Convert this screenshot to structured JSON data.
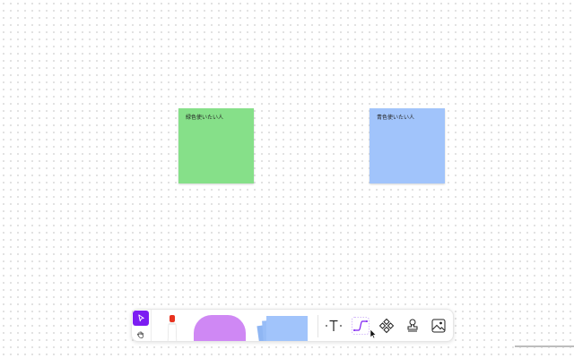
{
  "canvas": {
    "notes": [
      {
        "text": "緑色使いたい人",
        "color": "#86e089"
      },
      {
        "text": "青色使いたい人",
        "color": "#a1c4fb"
      }
    ]
  },
  "toolbar": {
    "modes": [
      {
        "name": "select",
        "icon": "pointer-icon",
        "active": true,
        "accent": "#7c1cf2"
      },
      {
        "name": "hand",
        "icon": "hand-icon",
        "active": false
      }
    ],
    "tools": [
      {
        "name": "marker",
        "icon": "marker-icon",
        "tip_color": "#e8321f"
      },
      {
        "name": "shape",
        "icon": "shape-icon",
        "color": "#cf88f4"
      },
      {
        "name": "sticky-note",
        "icon": "sticky-note-stack-icon",
        "color": "#a1c4fb"
      },
      {
        "name": "text",
        "icon": "text-icon",
        "label": "T"
      },
      {
        "name": "connector",
        "icon": "connector-line-icon",
        "active": true
      },
      {
        "name": "component",
        "icon": "component-icon"
      },
      {
        "name": "stamp",
        "icon": "stamp-icon"
      },
      {
        "name": "image",
        "icon": "image-icon"
      }
    ]
  }
}
